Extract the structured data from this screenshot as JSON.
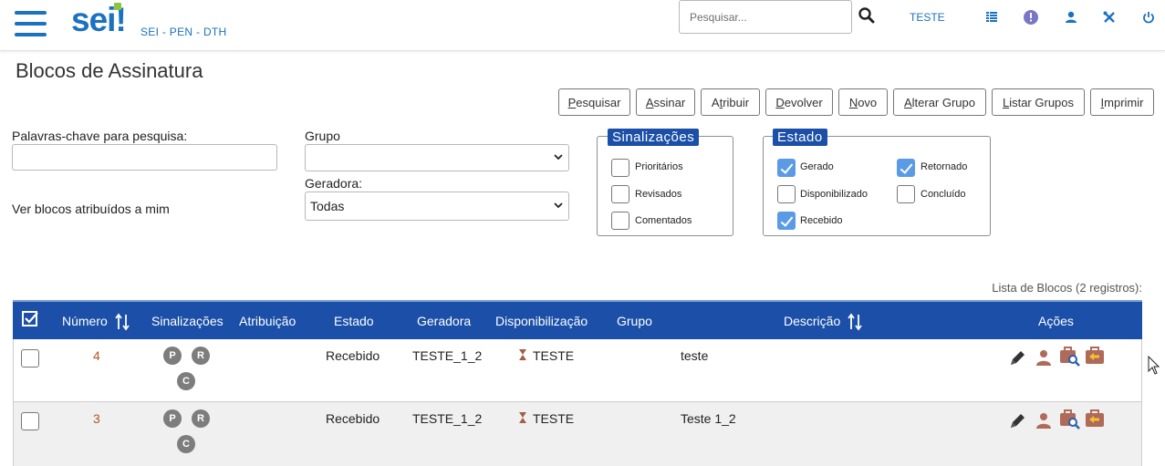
{
  "header": {
    "logo_text": "sei",
    "logo_suffix": "!",
    "org": "SEI - PEN - DTH",
    "search_placeholder": "Pesquisar...",
    "user": "TESTE",
    "icons": [
      "menu-icon",
      "search-icon",
      "grid-icon",
      "notification-icon",
      "user-icon",
      "tools-icon",
      "power-icon"
    ],
    "accent": "#1b72c0",
    "brand_green": "#8cc63f"
  },
  "page": {
    "title": "Blocos de Assinatura"
  },
  "toolbar": {
    "buttons": [
      {
        "key": "P",
        "rest": "esquisar"
      },
      {
        "key": "A",
        "rest": "ssinar"
      },
      {
        "pre": "A",
        "key": "t",
        "rest": "ribuir"
      },
      {
        "key": "D",
        "rest": "evolver"
      },
      {
        "key": "N",
        "rest": "ovo"
      },
      {
        "key": "A",
        "rest": "lterar Grupo"
      },
      {
        "key": "L",
        "rest": "istar Grupos"
      },
      {
        "key": "I",
        "rest": "mprimir"
      }
    ]
  },
  "filters": {
    "keywords_label": "Palavras-chave para pesquisa:",
    "keywords_value": "",
    "group_label": "Grupo",
    "group_value": "",
    "generator_label": "Geradora:",
    "generator_value": "Todas",
    "assigned_label": "Ver blocos atribuídos a mim",
    "signals": {
      "legend": "Sinalizações",
      "options": [
        {
          "label": "Prioritários",
          "checked": false
        },
        {
          "label": "Revisados",
          "checked": false
        },
        {
          "label": "Comentados",
          "checked": false
        }
      ]
    },
    "state": {
      "legend": "Estado",
      "options": [
        {
          "label": "Gerado",
          "checked": true
        },
        {
          "label": "Retornado",
          "checked": true
        },
        {
          "label": "Disponibilizado",
          "checked": false
        },
        {
          "label": "Concluído",
          "checked": false
        },
        {
          "label": "Recebido",
          "checked": true
        }
      ]
    }
  },
  "table": {
    "caption": "Lista de Blocos (2 registros):",
    "header_color": "#1b4fa8",
    "columns": [
      "Número",
      "Sinalizações",
      "Atribuição",
      "Estado",
      "Geradora",
      "Disponibilização",
      "Grupo",
      "Descrição",
      "Ações"
    ],
    "rows": [
      {
        "numero": "4",
        "badges": [
          "P",
          "R",
          "C"
        ],
        "atribuicao": "",
        "estado": "Recebido",
        "geradora": "TESTE_1_2",
        "disponibilizacao": "TESTE",
        "grupo": "",
        "descricao": "teste",
        "acoes": [
          "sign-icon",
          "assign-user-icon",
          "view-documents-icon",
          "return-block-icon"
        ]
      },
      {
        "numero": "3",
        "badges": [
          "P",
          "R",
          "C"
        ],
        "atribuicao": "",
        "estado": "Recebido",
        "geradora": "TESTE_1_2",
        "disponibilizacao": "TESTE",
        "grupo": "",
        "descricao": "Teste 1_2",
        "acoes": [
          "sign-icon",
          "assign-user-icon",
          "view-documents-icon",
          "return-block-icon"
        ]
      }
    ]
  }
}
